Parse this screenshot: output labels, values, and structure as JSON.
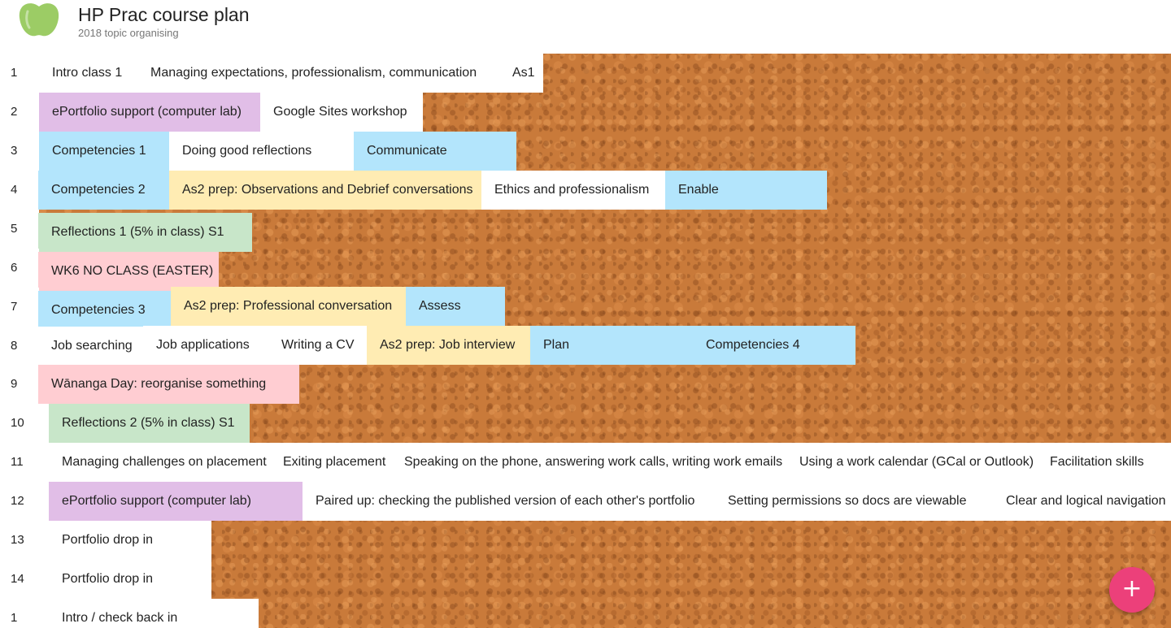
{
  "header": {
    "title": "HP Prac course plan",
    "subtitle": "2018 topic organising",
    "logo_icon": "green-apple-icon"
  },
  "rows": [
    {
      "num": "1",
      "cards": [
        {
          "text": "Intro class 1",
          "color": "white"
        },
        {
          "text": "Managing expectations, professionalism, communication",
          "color": "white"
        },
        {
          "text": "As1",
          "color": "white"
        }
      ]
    },
    {
      "num": "2",
      "cards": [
        {
          "text": "ePortfolio support (computer lab)",
          "color": "purple"
        },
        {
          "text": "Google Sites workshop",
          "color": "white"
        }
      ]
    },
    {
      "num": "3",
      "cards": [
        {
          "text": "Competencies 1",
          "color": "blue"
        },
        {
          "text": "Doing good reflections",
          "color": "white"
        },
        {
          "text": "Communicate",
          "color": "blue"
        }
      ]
    },
    {
      "num": "4",
      "cards": [
        {
          "text": "Competencies 2",
          "color": "blue"
        },
        {
          "text": "As2 prep: Observations and Debrief conversations",
          "color": "yellow"
        },
        {
          "text": "Ethics and professionalism",
          "color": "white"
        },
        {
          "text": "Enable",
          "color": "blue"
        }
      ]
    },
    {
      "num": "5",
      "cards": [
        {
          "text": "Reflections 1 (5% in class) S1",
          "color": "green"
        }
      ]
    },
    {
      "num": "6",
      "cards": [
        {
          "text": "WK6 NO CLASS (EASTER)",
          "color": "pink"
        }
      ]
    },
    {
      "num": "7",
      "cards": [
        {
          "text": "Competencies 3",
          "color": "blue"
        },
        {
          "text": "As2 prep: Professional conversation",
          "color": "yellow"
        },
        {
          "text": "Assess",
          "color": "blue"
        }
      ]
    },
    {
      "num": "8",
      "cards": [
        {
          "text": "Job searching",
          "color": "white"
        },
        {
          "text": "Job applications",
          "color": "white"
        },
        {
          "text": "Writing a CV",
          "color": "white"
        },
        {
          "text": "As2 prep: Job interview",
          "color": "yellow"
        },
        {
          "text": "Plan",
          "color": "blue"
        },
        {
          "text": "Competencies 4",
          "color": "blue"
        }
      ]
    },
    {
      "num": "9",
      "cards": [
        {
          "text": "Wānanga Day: reorganise something",
          "color": "pink"
        }
      ]
    },
    {
      "num": "10",
      "cards": [
        {
          "text": "Reflections 2 (5% in class) S1",
          "color": "green"
        }
      ]
    },
    {
      "num": "11",
      "cards": [
        {
          "text": "Managing challenges on placement",
          "color": "white"
        },
        {
          "text": "Exiting placement",
          "color": "white"
        },
        {
          "text": "Speaking on the phone, answering work calls, writing work emails",
          "color": "white"
        },
        {
          "text": "Using a work calendar (GCal or Outlook)",
          "color": "white"
        },
        {
          "text": "Facilitation skills",
          "color": "white"
        }
      ]
    },
    {
      "num": "12",
      "cards": [
        {
          "text": "ePortfolio support (computer lab)",
          "color": "purple"
        },
        {
          "text": "Paired up: checking the published version of each other's portfolio",
          "color": "white"
        },
        {
          "text": "Setting permissions so docs are viewable",
          "color": "white"
        },
        {
          "text": "Clear and logical navigation",
          "color": "white"
        }
      ]
    },
    {
      "num": "13",
      "cards": [
        {
          "text": "Portfolio drop in",
          "color": "white"
        }
      ]
    },
    {
      "num": "14",
      "cards": [
        {
          "text": "Portfolio drop in",
          "color": "white"
        }
      ]
    },
    {
      "num": "1",
      "cards": [
        {
          "text": "Intro / check back in",
          "color": "white"
        }
      ]
    }
  ],
  "fab": {
    "label": "+",
    "icon": "plus-icon",
    "color": "#ec407a"
  },
  "colors": {
    "white": "#ffffff",
    "blue": "#b3e5fc",
    "purple": "#e1bee7",
    "yellow": "#ffecb3",
    "green": "#c8e6c9",
    "pink": "#ffcdd2"
  }
}
